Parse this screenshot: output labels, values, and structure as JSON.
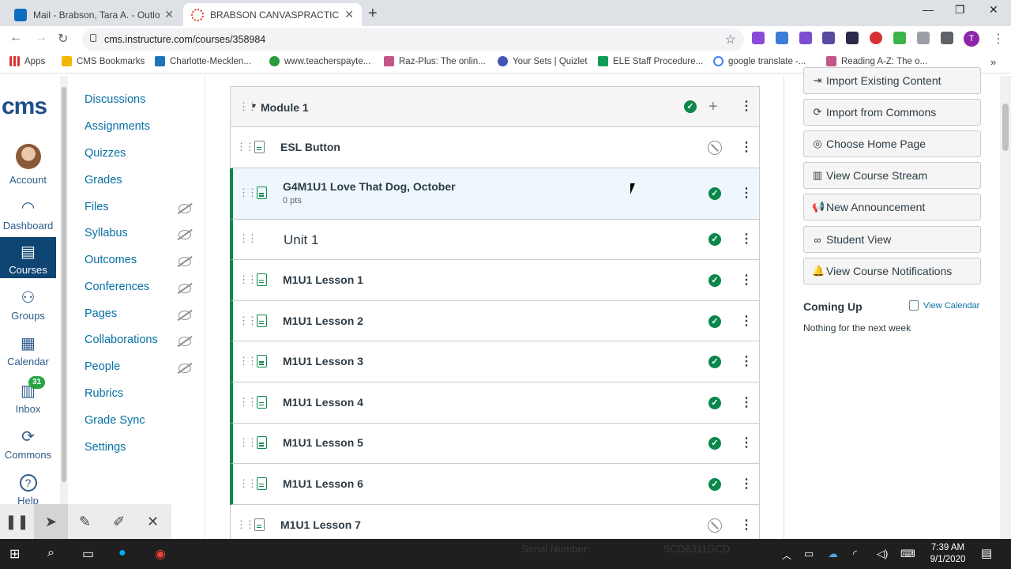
{
  "browser": {
    "tabs": [
      {
        "title": "Mail - Brabson, Tara A. - Outlook",
        "favicon": "outlook-icon",
        "color": "#0f6cbd"
      },
      {
        "title": "BRABSON CANVASPRACTICE",
        "favicon": "canvas-icon",
        "color": "#e03e2d"
      }
    ],
    "url": "cms.instructure.com/courses/358984",
    "profile_initial": "T",
    "bookmarks": [
      "Apps",
      "CMS Bookmarks",
      "Charlotte-Mecklen...",
      "www.teacherspayte...",
      "Raz-Plus: The onlin...",
      "Your Sets | Quizlet",
      "ELE Staff Procedure...",
      "google translate -...",
      "Reading A-Z: The o..."
    ]
  },
  "global_nav": {
    "logo": "cms",
    "items": [
      {
        "label": "Account",
        "icon": "avatar"
      },
      {
        "label": "Dashboard",
        "icon": "dashboard-icon"
      },
      {
        "label": "Courses",
        "icon": "courses-icon",
        "active": true
      },
      {
        "label": "Groups",
        "icon": "groups-icon"
      },
      {
        "label": "Calendar",
        "icon": "calendar-icon"
      },
      {
        "label": "Inbox",
        "icon": "inbox-icon",
        "badge": "31"
      },
      {
        "label": "Commons",
        "icon": "commons-icon"
      },
      {
        "label": "Help",
        "icon": "help-icon"
      }
    ]
  },
  "course_nav": {
    "items": [
      {
        "label": "Discussions",
        "hidden": false
      },
      {
        "label": "Assignments",
        "hidden": false
      },
      {
        "label": "Quizzes",
        "hidden": false
      },
      {
        "label": "Grades",
        "hidden": false
      },
      {
        "label": "Files",
        "hidden": true
      },
      {
        "label": "Syllabus",
        "hidden": true
      },
      {
        "label": "Outcomes",
        "hidden": true
      },
      {
        "label": "Conferences",
        "hidden": true
      },
      {
        "label": "Pages",
        "hidden": true
      },
      {
        "label": "Collaborations",
        "hidden": true
      },
      {
        "label": "People",
        "hidden": true
      },
      {
        "label": "Rubrics",
        "hidden": false
      },
      {
        "label": "Grade Sync",
        "hidden": false
      },
      {
        "label": "Settings",
        "hidden": false
      }
    ]
  },
  "module": {
    "title": "Module 1",
    "items": [
      {
        "title": "ESL Button",
        "type": "page",
        "published": false
      },
      {
        "title": "G4M1U1 Love That Dog, October",
        "subtitle": "0 pts",
        "type": "assignment",
        "published": true
      },
      {
        "title": "Unit 1",
        "type": "subheader",
        "published": true
      },
      {
        "title": "M1U1 Lesson 1",
        "type": "page",
        "published": true
      },
      {
        "title": "M1U1 Lesson 2",
        "type": "page",
        "published": true
      },
      {
        "title": "M1U1 Lesson 3",
        "type": "page",
        "published": true
      },
      {
        "title": "M1U1 Lesson 4",
        "type": "page",
        "published": true
      },
      {
        "title": "M1U1 Lesson 5",
        "type": "page",
        "published": true
      },
      {
        "title": "M1U1 Lesson 6",
        "type": "page",
        "published": true
      },
      {
        "title": "M1U1 Lesson 7",
        "type": "page",
        "published": false
      }
    ]
  },
  "sidebar": {
    "buttons": [
      {
        "label": "Import Existing Content",
        "icon": "import-icon"
      },
      {
        "label": "Import from Commons",
        "icon": "commons-icon"
      },
      {
        "label": "Choose Home Page",
        "icon": "target-icon"
      },
      {
        "label": "View Course Stream",
        "icon": "stream-icon"
      },
      {
        "label": "New Announcement",
        "icon": "megaphone-icon"
      },
      {
        "label": "Student View",
        "icon": "glasses-icon"
      },
      {
        "label": "View Course Notifications",
        "icon": "bell-icon"
      }
    ],
    "coming_up": "Coming Up",
    "view_calendar": "View Calendar",
    "nothing": "Nothing for the next week"
  },
  "taskbar": {
    "time": "7:39 AM",
    "date": "9/1/2020",
    "watermark_label": "Serial Number:",
    "watermark_value": "SCD6311GCD"
  },
  "colors": {
    "published": "#0b874b",
    "link": "#0770a3",
    "nav_active": "#0e4573"
  }
}
